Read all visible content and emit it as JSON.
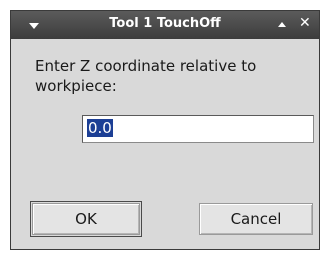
{
  "window": {
    "title": "Tool 1 TouchOff",
    "close_glyph": "✕",
    "menu_icon": "chevron-down-icon",
    "maximize_icon": "caret-up-icon"
  },
  "dialog": {
    "prompt": "Enter Z coordinate relative to workpiece:",
    "value": "0.0",
    "value_selected": true
  },
  "buttons": {
    "ok_label": "OK",
    "cancel_label": "Cancel"
  },
  "colors": {
    "titlebar": "#4a4a4a",
    "selection": "#1c3f95",
    "dialog_background": "#d9d9d9"
  }
}
